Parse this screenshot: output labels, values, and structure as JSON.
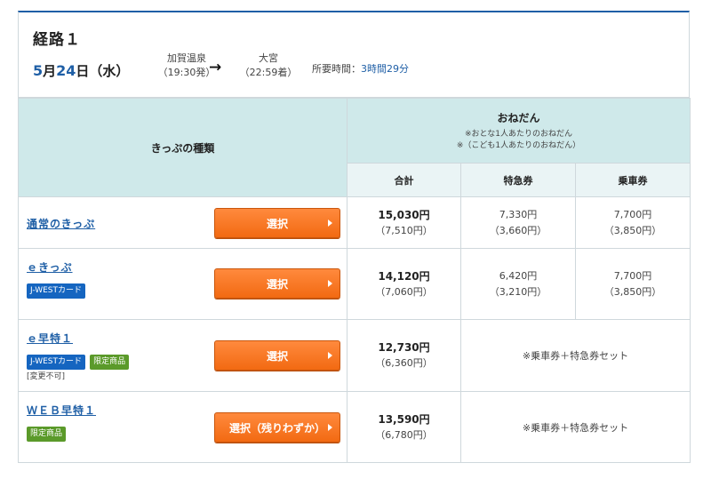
{
  "route": {
    "title": "経路１",
    "date": {
      "month": "5",
      "month_suffix": "月",
      "day": "24",
      "day_suffix": "日（水）"
    },
    "departure": {
      "station": "加賀温泉",
      "time": "（19:30発）"
    },
    "arrow": "→",
    "arrival": {
      "station": "大宮",
      "time": "（22:59着）"
    },
    "duration": {
      "label": "所要時間：",
      "value": "3時間29分"
    }
  },
  "table": {
    "ticket_type_header": "きっぷの種類",
    "price_header": "おねだん",
    "price_note_adult": "※おとな1人あたりのおねだん",
    "price_note_child": "※（こども1人あたりのおねだん）",
    "col_total": "合計",
    "col_express": "特急券",
    "col_fare": "乗車券",
    "rows": [
      {
        "name": "通常のきっぷ",
        "button": "選択",
        "total": "15,030円",
        "total_child": "（7,510円）",
        "express": "7,330円",
        "express_child": "（3,660円）",
        "fare": "7,700円",
        "fare_child": "（3,850円）"
      },
      {
        "name": "ｅきっぷ",
        "badge_card": "J-WESTカード",
        "button": "選択",
        "total": "14,120円",
        "total_child": "（7,060円）",
        "express": "6,420円",
        "express_child": "（3,210円）",
        "fare": "7,700円",
        "fare_child": "（3,850円）"
      },
      {
        "name": "ｅ早特１",
        "badge_card": "J-WESTカード",
        "badge_limited": "限定商品",
        "note": "[変更不可]",
        "button": "選択",
        "total": "12,730円",
        "total_child": "（6,360円）",
        "set_note": "※乗車券＋特急券セット"
      },
      {
        "name": "ＷＥＢ早特１",
        "badge_limited": "限定商品",
        "button": "選択（残りわずか）",
        "total": "13,590円",
        "total_child": "（6,780円）",
        "set_note": "※乗車券＋特急券セット"
      }
    ]
  },
  "colors": {
    "accent_blue": "#1f5fa6",
    "header_teal": "#cfe9ea",
    "button_orange": "#f26a12",
    "badge_blue": "#1565c0",
    "badge_green": "#5b9a2a"
  }
}
